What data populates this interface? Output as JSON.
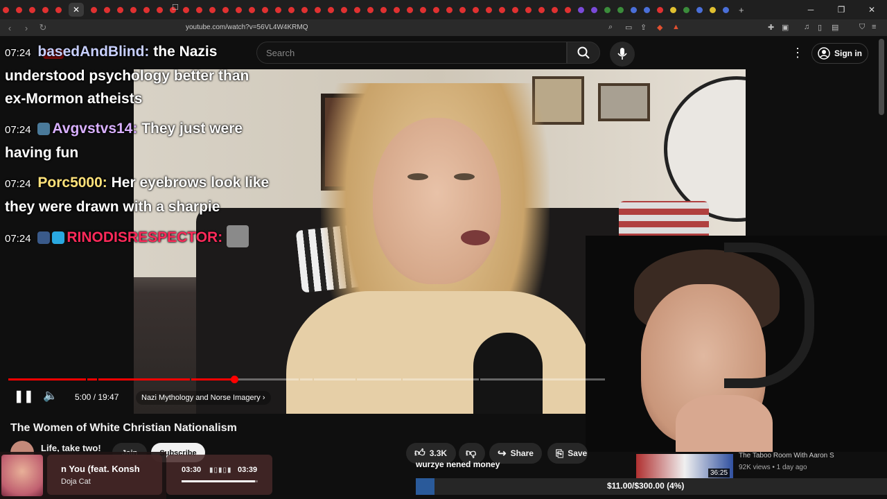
{
  "browser": {
    "url": "youtube.com/watch?v=56VL4W4KRMQ",
    "window_buttons": [
      "─",
      "❐",
      "✕"
    ]
  },
  "header": {
    "search_placeholder": "Search",
    "sign_in_label": "Sign in"
  },
  "chat": [
    {
      "time": "07:24",
      "user": "basedAndBlind",
      "message": "the Nazis understood psychology better than ex-Mormon atheists"
    },
    {
      "time": "07:24",
      "user": "Avgvstvs14",
      "message": "They just were having fun"
    },
    {
      "time": "07:24",
      "user": "Porc5000",
      "message": "Her eyebrows look like they were drawn with a sharpie"
    },
    {
      "time": "07:24",
      "user": "RINODISRESPECTOR",
      "message": ""
    }
  ],
  "player": {
    "time_display": "5:00 / 19:47",
    "chapter_label": "Nazi Mythology and Norse Imagery",
    "progress_fraction": 0.253
  },
  "video": {
    "title": "The Women of White Christian Nationalism",
    "channel_name": "Life, take two!",
    "join_label": "Join",
    "subscribe_label": "Subscribe",
    "like_count": "3.3K",
    "share_label": "Share",
    "save_label": "Save"
  },
  "recommended": {
    "title": "The Taboo Room With Aaron S",
    "meta": "92K views • 1 day ago",
    "duration": "36:25"
  },
  "now_playing": {
    "song": "n You (feat. Konsh",
    "artist": "Doja Cat",
    "elapsed": "03:30",
    "total": "03:39",
    "progress_fraction": 0.96
  },
  "caption_text": "wurzye nened money",
  "donation_goal": {
    "text": "$11.00/$300.00 (4%)",
    "fraction": 0.04
  },
  "colors": {
    "accent_red": "#ff0000",
    "user1": "#c8d0ff",
    "user2": "#d9b0ff",
    "user3": "#ffe27a",
    "user4": "#ff2a5a"
  }
}
